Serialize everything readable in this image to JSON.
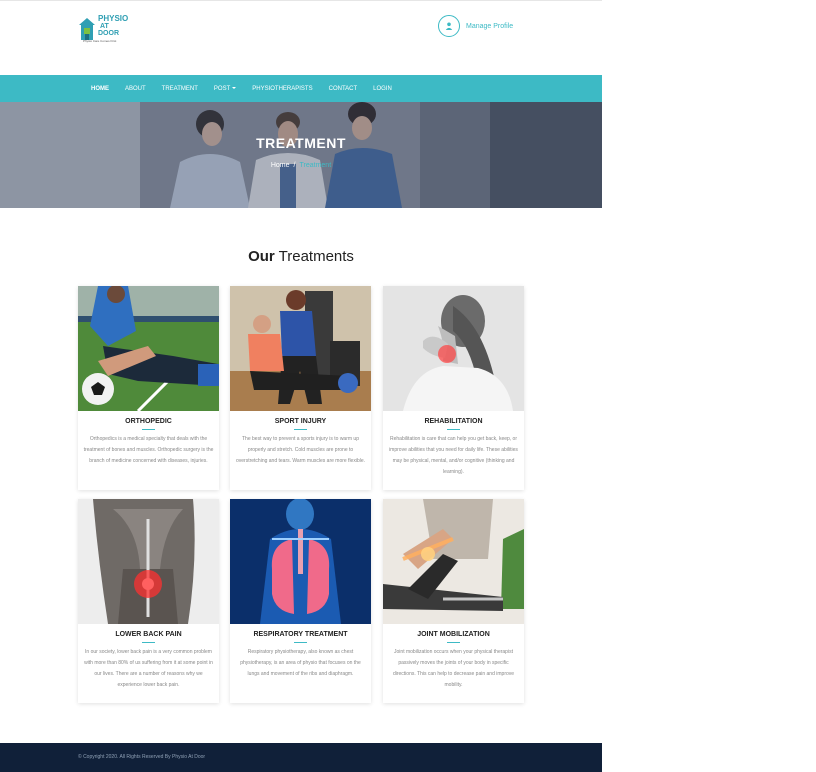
{
  "header": {
    "logo_word1": "PHYSIO",
    "logo_word2": "AT",
    "logo_word3": "DOOR",
    "logo_tagline": "Physio Care Comes First",
    "profile_icon": "user-icon",
    "profile_label": "Manage Profile"
  },
  "nav": {
    "items": [
      {
        "label": "HOME",
        "active": true
      },
      {
        "label": "ABOUT"
      },
      {
        "label": "TREATMENT"
      },
      {
        "label": "POST",
        "dropdown": true
      },
      {
        "label": "PHYSIOTHERAPISTS"
      },
      {
        "label": "CONTACT"
      },
      {
        "label": "LOGIN"
      }
    ]
  },
  "hero": {
    "title": "TREATMENT",
    "breadcrumb_home": "Home",
    "breadcrumb_sep": "/",
    "breadcrumb_current": "Treatment"
  },
  "section": {
    "title_bold": "Our",
    "title_rest": " Treatments"
  },
  "cards": [
    {
      "name": "ORTHOPEDIC",
      "desc": "Orthopedics is a medical specialty that deals with the treatment of bones and muscles. Orthopedic surgery is the branch of medicine concerned with diseases, injuries."
    },
    {
      "name": "SPORT INJURY",
      "desc": "The best way to prevent a sports injury is to warm up properly and stretch. Cold muscles are prone to overstretching and tears. Warm muscles are more flexible."
    },
    {
      "name": "REHABILITATION",
      "desc": "Rehabilitation is care that can help you get back, keep, or improve abilities that you need for daily life. These abilities may be physical, mental, and/or cognitive (thinking and learning)."
    },
    {
      "name": "LOWER BACK PAIN",
      "desc": "In our society, lower back pain is a very common problem with more than 80% of us suffering from it at some point in our lives. There are a number of reasons why we experience lower back pain."
    },
    {
      "name": "RESPIRATORY TREATMENT",
      "desc": "Respiratory physiotherapy, also known as chest physiotherapy, is an area of physio that focuses on the lungs and movement of the ribs and diaphragm."
    },
    {
      "name": "JOINT MOBILIZATION",
      "desc": "Joint mobilization occurs when your physical therapist passively moves the joints of your body in specific directions. This can help to decrease pain and improve mobility."
    }
  ],
  "footer": {
    "copyright": "© Copyright 2020. All Rights Reserved By Physio At Door"
  },
  "colors": {
    "accent": "#3dbac5",
    "footer_bg": "#102039"
  }
}
